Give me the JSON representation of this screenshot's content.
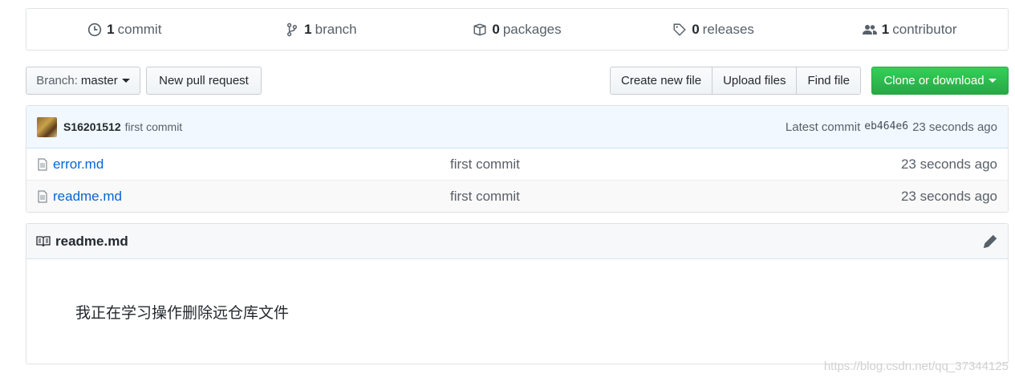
{
  "summary": {
    "commits": {
      "count": "1",
      "label": "commit",
      "icon": "history-icon"
    },
    "branches": {
      "count": "1",
      "label": "branch",
      "icon": "branch-icon"
    },
    "packages": {
      "count": "0",
      "label": "packages",
      "icon": "package-icon"
    },
    "releases": {
      "count": "0",
      "label": "releases",
      "icon": "tag-icon"
    },
    "contributors": {
      "count": "1",
      "label": "contributor",
      "icon": "people-icon"
    }
  },
  "toolbar": {
    "branch_prefix": "Branch:",
    "branch_name": "master",
    "new_pull_request": "New pull request",
    "create_new_file": "Create new file",
    "upload_files": "Upload files",
    "find_file": "Find file",
    "clone_or_download": "Clone or download"
  },
  "latest_commit": {
    "author": "S16201512",
    "message": "first commit",
    "prefix": "Latest commit",
    "sha": "eb464e6",
    "age": "23 seconds ago"
  },
  "files": [
    {
      "name": "error.md",
      "message": "first commit",
      "age": "23 seconds ago"
    },
    {
      "name": "readme.md",
      "message": "first commit",
      "age": "23 seconds ago"
    }
  ],
  "readme": {
    "title": "readme.md",
    "content": "我正在学习操作删除远仓库文件"
  },
  "watermark": "https://blog.csdn.net/qq_37344125",
  "colors": {
    "accent": "#0366d6",
    "green": "#28a745",
    "commit_bar": "#f1f8ff"
  }
}
